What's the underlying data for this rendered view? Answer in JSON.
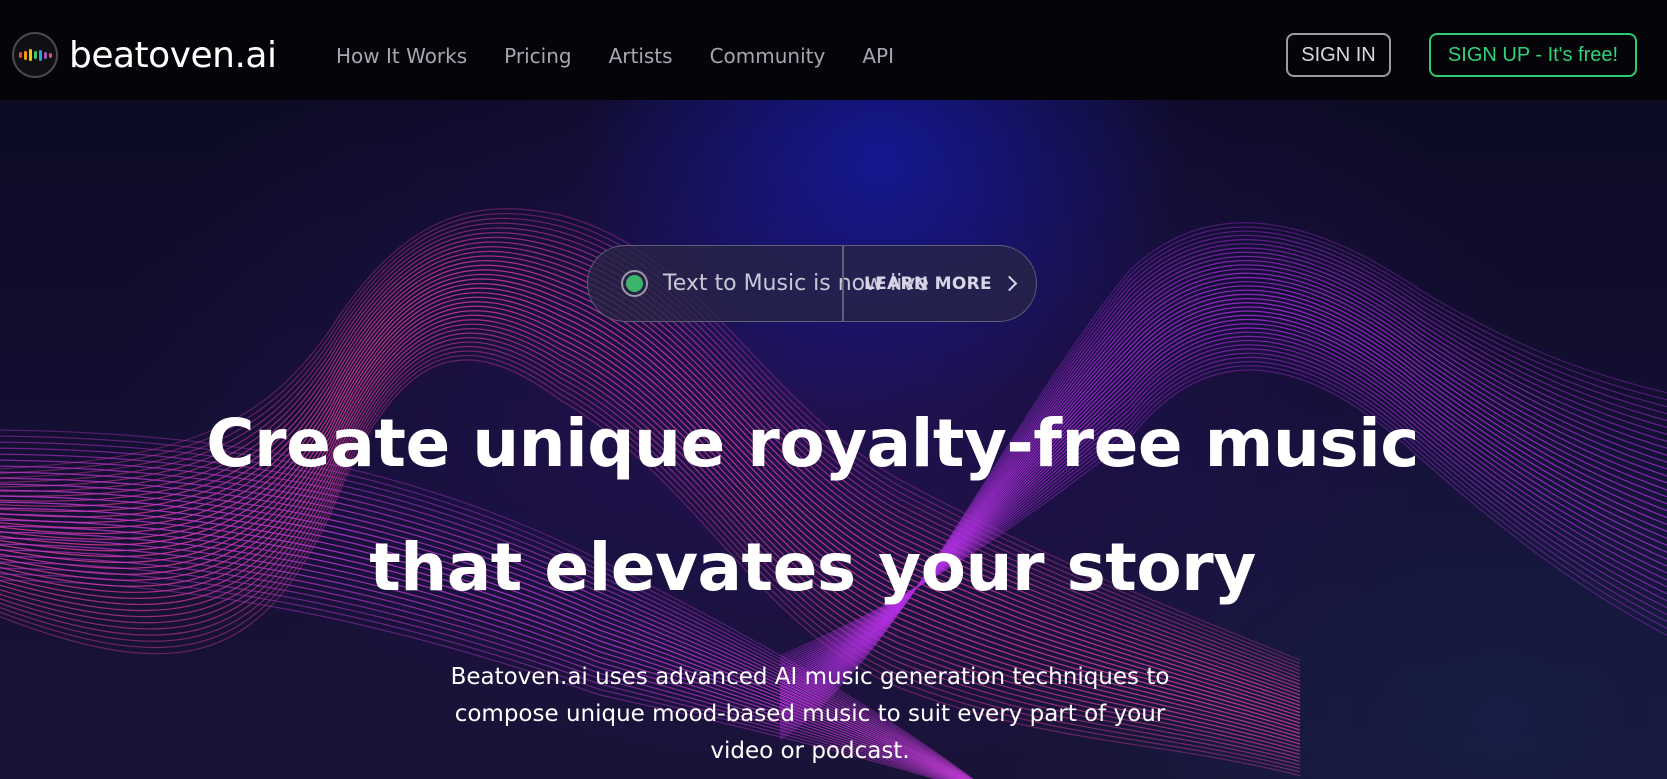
{
  "brand": {
    "name": "beatoven.ai",
    "icon": "equalizer-bars-logo",
    "bar_colors": [
      "#e74c3c",
      "#f39c12",
      "#f1c40f",
      "#2ecc71",
      "#3498db",
      "#9b59b6",
      "#e84393"
    ]
  },
  "nav": {
    "links": [
      "How It Works",
      "Pricing",
      "Artists",
      "Community",
      "API"
    ],
    "sign_in": "SIGN IN",
    "sign_up": "SIGN UP - It's free!"
  },
  "announcement": {
    "text": "Text to Music is now live",
    "cta": "LEARN MORE",
    "cta_icon": "chevron-right-icon",
    "status_color": "#3cb56a"
  },
  "hero": {
    "headline_line1": "Create unique royalty-free music",
    "headline_line2": "that elevates your story",
    "description_line1": "Beatoven.ai uses advanced AI music generation techniques to",
    "description_line2": "compose unique mood-based music to suit every part of your",
    "description_line3": "video or podcast."
  },
  "colors": {
    "accent_green": "#2ecc71",
    "wave_pink": "#e0409a",
    "wave_purple": "#b030e0",
    "background": "#0b0a1c"
  }
}
